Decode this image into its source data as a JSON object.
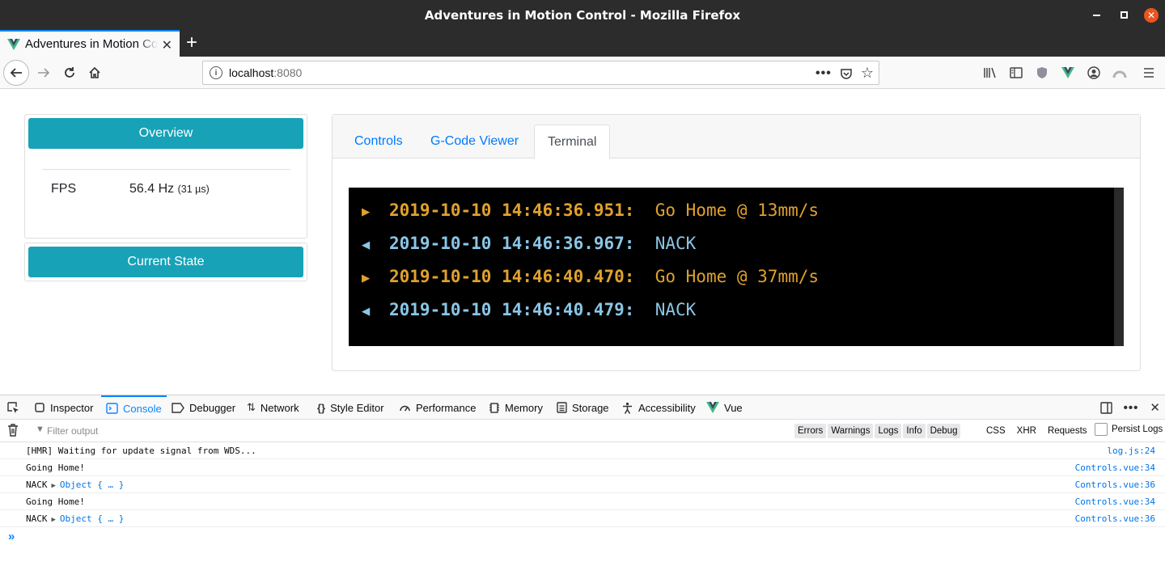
{
  "window": {
    "title": "Adventures in Motion Control - Mozilla Firefox"
  },
  "browser": {
    "tab_title": "Adventures in Motion Control",
    "url_host": "localhost",
    "url_port": ":8080"
  },
  "sidebar": {
    "overview_label": "Overview",
    "fps_label": "FPS",
    "fps_value": "56.4 Hz",
    "fps_sub": "(31 µs)",
    "current_state_label": "Current State"
  },
  "main": {
    "tabs": [
      {
        "label": "Controls",
        "active": false
      },
      {
        "label": "G-Code Viewer",
        "active": false
      },
      {
        "label": "Terminal",
        "active": true
      }
    ]
  },
  "terminal": {
    "lines": [
      {
        "direction": "out",
        "arrow": "▶",
        "timestamp": "2019-10-10 14:46:36.951:",
        "message": "Go Home @ 13mm/s"
      },
      {
        "direction": "in",
        "arrow": "◀",
        "timestamp": "2019-10-10 14:46:36.967:",
        "message": "NACK"
      },
      {
        "direction": "out",
        "arrow": "▶",
        "timestamp": "2019-10-10 14:46:40.470:",
        "message": "Go Home @ 37mm/s"
      },
      {
        "direction": "in",
        "arrow": "◀",
        "timestamp": "2019-10-10 14:46:40.479:",
        "message": "NACK"
      }
    ],
    "colors": {
      "out": "#e0a12e",
      "in": "#8ac6e6"
    }
  },
  "devtools": {
    "tabs": [
      "Inspector",
      "Console",
      "Debugger",
      "Network",
      "Style Editor",
      "Performance",
      "Memory",
      "Storage",
      "Accessibility",
      "Vue"
    ],
    "active_tab": "Console",
    "filter_placeholder": "Filter output",
    "levels": [
      "Errors",
      "Warnings",
      "Logs",
      "Info",
      "Debug"
    ],
    "request_filters": [
      "CSS",
      "XHR",
      "Requests"
    ],
    "persist_logs_label": "Persist Logs",
    "rows": [
      {
        "message": "[HMR] Waiting for update signal from WDS...",
        "object": "",
        "location": "log.js:24"
      },
      {
        "message": "Going Home!",
        "object": "",
        "location": "Controls.vue:34"
      },
      {
        "message": "NACK",
        "object": "Object { … }",
        "location": "Controls.vue:36"
      },
      {
        "message": "Going Home!",
        "object": "",
        "location": "Controls.vue:34"
      },
      {
        "message": "NACK",
        "object": "Object { … }",
        "location": "Controls.vue:36"
      }
    ]
  },
  "theme": {
    "accent": "#17a2b8",
    "link": "#007bff",
    "firefox_blue": "#0a84ff",
    "close_button": "#e95420"
  }
}
